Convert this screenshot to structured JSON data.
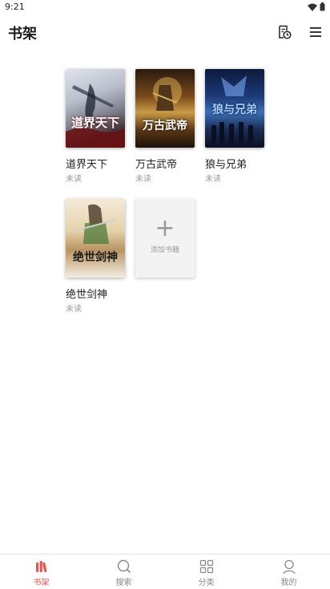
{
  "status_bar": {
    "time": "9:21"
  },
  "app_bar": {
    "title": "书架"
  },
  "books": [
    {
      "title": "道界天下",
      "status": "未读",
      "cover_text": "道界天下"
    },
    {
      "title": "万古武帝",
      "status": "未读",
      "cover_text": "万古武帝"
    },
    {
      "title": "狼与兄弟",
      "status": "未读",
      "cover_text": "狼与兄弟"
    },
    {
      "title": "绝世剑神",
      "status": "未读",
      "cover_text": "绝世剑神"
    }
  ],
  "add_book": {
    "label": "添加书籍"
  },
  "bottom_nav": {
    "items": [
      {
        "label": "书架"
      },
      {
        "label": "搜索"
      },
      {
        "label": "分类"
      },
      {
        "label": "我的"
      }
    ]
  },
  "colors": {
    "accent": "#e8544f"
  }
}
